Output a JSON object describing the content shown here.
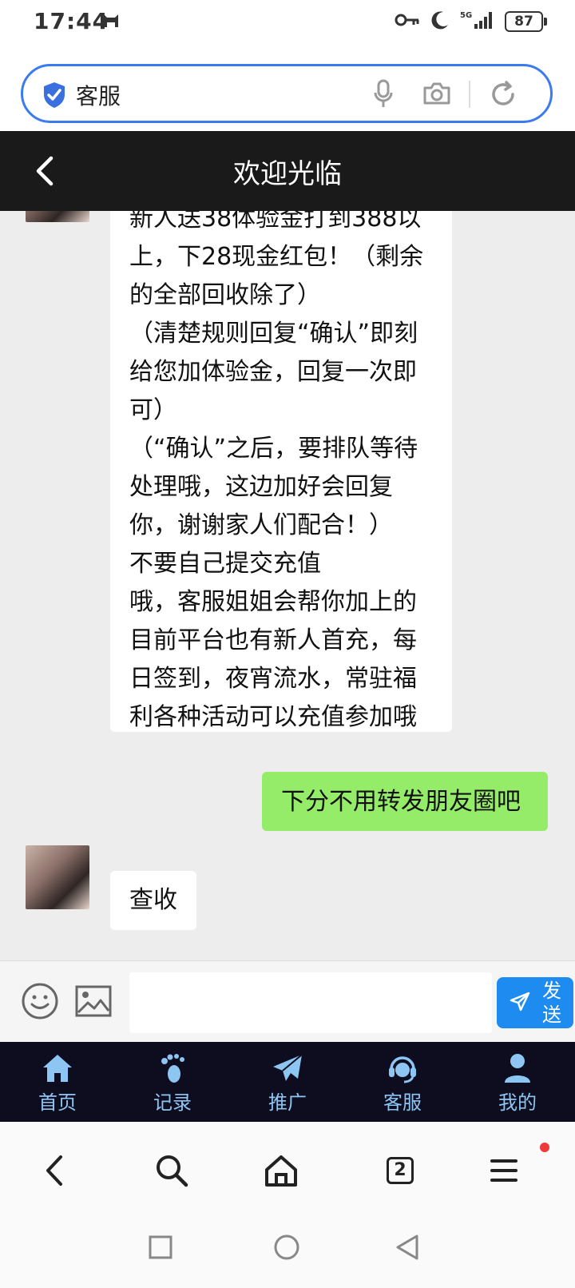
{
  "status_bar": {
    "time": "17:44",
    "network": "5G",
    "battery": "87"
  },
  "browser": {
    "address_text": "客服",
    "tab_count": "2"
  },
  "chat": {
    "title": "欢迎光临",
    "messages": [
      {
        "side": "left",
        "text": "新人送38体验金打到388以\n上，下28现金红包！（剩余\n的全部回收除了）\n（清楚规则回复“确认”即刻\n给您加体验金，回复一次即\n可）\n（“确认”之后，要排队等待\n处理哦，这边加好会回复\n你，谢谢家人们配合！）\n      不要自己提交充值\n哦，客服姐姐会帮你加上的\n目前平台也有新人首充，每\n日签到，夜宵流水，常驻福\n利各种活动可以充值参加哦"
      },
      {
        "side": "right",
        "text": "下分不用转发朋友圈吧"
      },
      {
        "side": "left",
        "text": "查收"
      }
    ]
  },
  "input": {
    "placeholder": "",
    "send_label": "发送"
  },
  "bottom_nav": [
    {
      "label": "首页",
      "icon": "home-icon"
    },
    {
      "label": "记录",
      "icon": "footprint-icon"
    },
    {
      "label": "推广",
      "icon": "paper-plane-icon"
    },
    {
      "label": "客服",
      "icon": "headset-icon"
    },
    {
      "label": "我的",
      "icon": "user-icon"
    }
  ],
  "colors": {
    "accent": "#1e8bf0",
    "self_bubble": "#95ec69",
    "header": "#1a1a1a",
    "nav_bg": "#0d0d1f",
    "nav_text": "#8ec6f3"
  }
}
